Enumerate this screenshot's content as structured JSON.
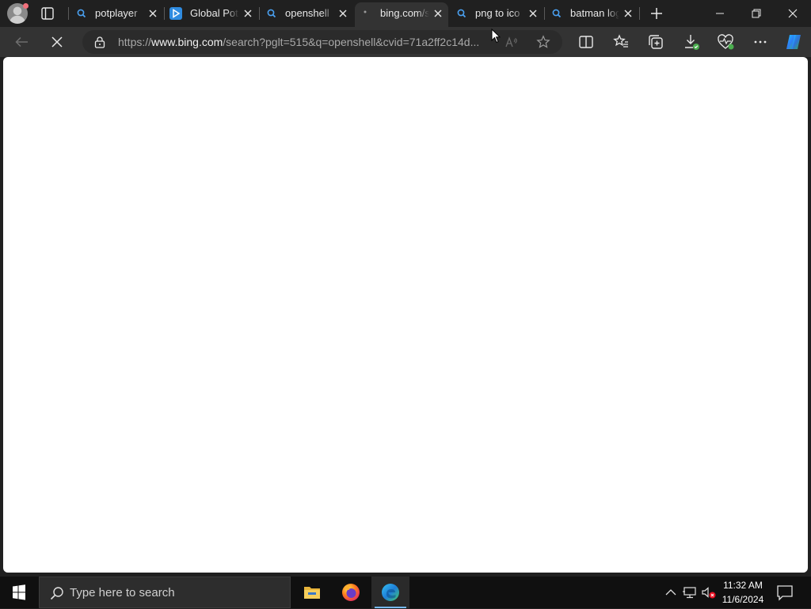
{
  "tabs": [
    {
      "title": "potplayer",
      "icon": "bing-search-icon"
    },
    {
      "title": "Global Potplayer",
      "icon": "potplayer-icon"
    },
    {
      "title": "openshell",
      "icon": "bing-search-icon"
    },
    {
      "title": "bing.com/search?pglt",
      "icon": "loading-dot-icon",
      "active": true
    },
    {
      "title": "png to ico",
      "icon": "bing-search-icon"
    },
    {
      "title": "batman logo",
      "icon": "bing-search-icon"
    }
  ],
  "address_bar": {
    "url_prefix": "https://",
    "url_host": "www.bing.com",
    "url_rest": "/search?pglt=515&q=openshell&cvid=71a2ff2c14d..."
  },
  "taskbar": {
    "search_placeholder": "Type here to search",
    "apps": [
      "file-explorer-icon",
      "firefox-icon",
      "edge-icon"
    ],
    "time": "11:32 AM",
    "date": "11/6/2024"
  },
  "colors": {
    "titlebar": "#202020",
    "toolbar": "#333333",
    "accent": "#76b9ed",
    "taskbar": "#101010"
  }
}
